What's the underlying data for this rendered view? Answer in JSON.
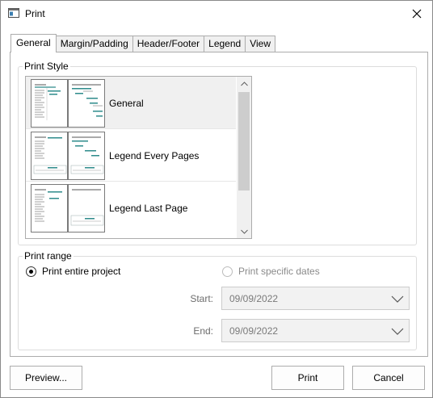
{
  "window": {
    "title": "Print",
    "app_icon": "print-window-icon",
    "close_icon": "close-icon"
  },
  "tabs": [
    {
      "label": "General",
      "active": true
    },
    {
      "label": "Margin/Padding",
      "active": false
    },
    {
      "label": "Header/Footer",
      "active": false
    },
    {
      "label": "Legend",
      "active": false
    },
    {
      "label": "View",
      "active": false
    }
  ],
  "print_style": {
    "group_label": "Print Style",
    "items": [
      {
        "label": "General",
        "selected": true
      },
      {
        "label": "Legend Every Pages",
        "selected": false
      },
      {
        "label": "Legend Last Page",
        "selected": false
      }
    ]
  },
  "print_range": {
    "group_label": "Print range",
    "entire_label": "Print entire project",
    "entire_checked": true,
    "specific_label": "Print specific dates",
    "specific_checked": false,
    "start_label": "Start:",
    "start_value": "09/09/2022",
    "end_label": "End:",
    "end_value": "09/09/2022"
  },
  "buttons": {
    "preview": "Preview...",
    "print": "Print",
    "cancel": "Cancel"
  },
  "colors": {
    "selected_row": "#f0f0f0",
    "gantt_bar": "#2e8b8b",
    "disabled_text": "#7a7a7a"
  }
}
